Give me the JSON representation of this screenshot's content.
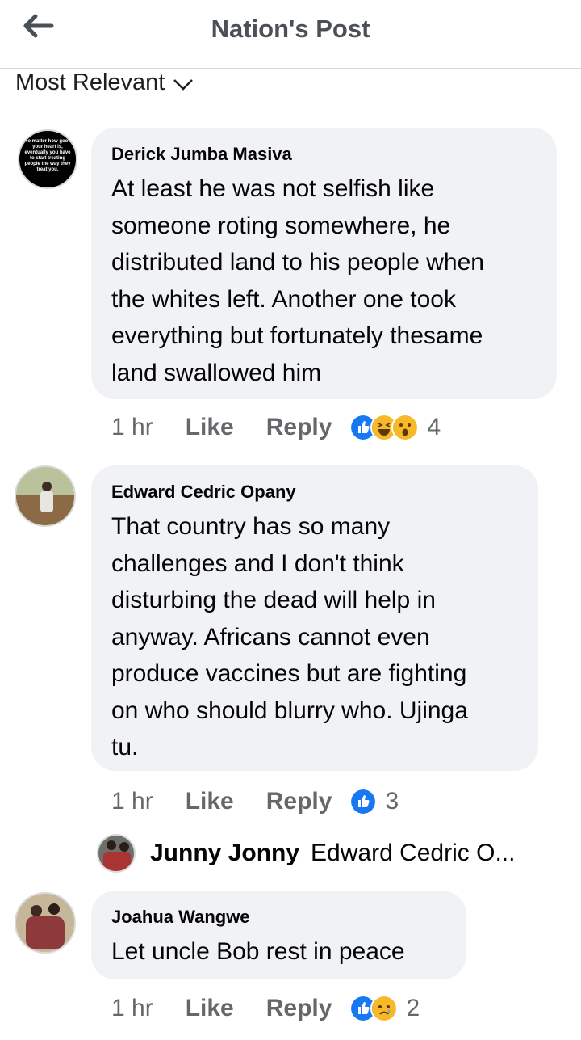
{
  "header": {
    "title": "Nation's Post"
  },
  "sort": {
    "label": "Most Relevant"
  },
  "comments": [
    {
      "author": "Derick Jumba Masiva",
      "avatar_text": "No matter how good your heart is, eventually you have to start treating people the way they treat you.",
      "lines": [
        "At least he was not selfish like",
        "someone roting somewhere, he",
        "distributed land to his people when",
        "the whites left. Another one took",
        "everything but fortunately thesame",
        "land swallowed him"
      ],
      "time": "1 hr",
      "like_label": "Like",
      "reply_label": "Reply",
      "reactions": [
        "like-reaction",
        "haha-reaction",
        "wow-reaction"
      ],
      "reaction_count": "4"
    },
    {
      "author": "Edward Cedric Opany",
      "lines": [
        "That country has so many",
        "challenges and I don't think",
        "disturbing the dead will help in",
        "anyway. Africans cannot even",
        "produce vaccines but are fighting",
        "on who should blurry who. Ujinga",
        "tu."
      ],
      "time": "1 hr",
      "like_label": "Like",
      "reply_label": "Reply",
      "reactions": [
        "like-reaction"
      ],
      "reaction_count": "3",
      "reply_preview": {
        "author": "Junny Jonny",
        "snippet": "Edward Cedric O..."
      }
    },
    {
      "author": "Joahua Wangwe",
      "lines": [
        "Let uncle Bob  rest in peace"
      ],
      "time": "1 hr",
      "like_label": "Like",
      "reply_label": "Reply",
      "reactions": [
        "like-reaction",
        "sad-reaction"
      ],
      "reaction_count": "2"
    }
  ],
  "colors": {
    "like_blue": "#1877f2",
    "reaction_yellow": "#f7b928",
    "bubble": "#f0f2f5",
    "meta_gray": "#65676b"
  }
}
